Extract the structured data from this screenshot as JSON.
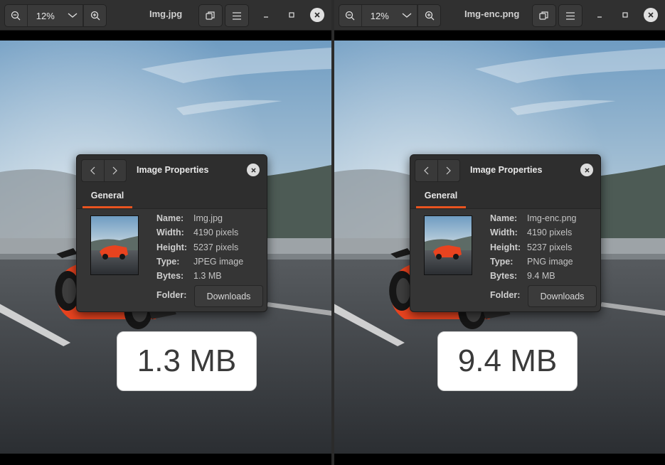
{
  "windows": [
    {
      "zoom": "12%",
      "title": "Img.jpg",
      "dialog": {
        "title": "Image Properties",
        "tab": "General",
        "labels": {
          "name": "Name:",
          "width": "Width:",
          "height": "Height:",
          "type": "Type:",
          "bytes": "Bytes:",
          "folder": "Folder:"
        },
        "name": "Img.jpg",
        "width": "4190 pixels",
        "height": "5237 pixels",
        "type": "JPEG image",
        "bytes": "1.3 MB",
        "folder": "Downloads"
      },
      "size_label": "1.3 MB"
    },
    {
      "zoom": "12%",
      "title": "Img-enc.png",
      "dialog": {
        "title": "Image Properties",
        "tab": "General",
        "labels": {
          "name": "Name:",
          "width": "Width:",
          "height": "Height:",
          "type": "Type:",
          "bytes": "Bytes:",
          "folder": "Folder:"
        },
        "name": "Img-enc.png",
        "width": "4190 pixels",
        "height": "5237 pixels",
        "type": "PNG image",
        "bytes": "9.4 MB",
        "folder": "Downloads"
      },
      "size_label": "9.4 MB"
    }
  ],
  "icons": {
    "zoom_out": "zoom-out-icon",
    "zoom_dropdown": "chevron-down-icon",
    "zoom_in": "zoom-in-icon",
    "fit": "fit-window-icon",
    "menu": "hamburger-menu-icon",
    "minimize": "minimize-icon",
    "maximize": "maximize-icon",
    "close": "close-icon",
    "prev": "chevron-left-icon",
    "next": "chevron-right-icon"
  },
  "colors": {
    "headerbar": "#303030",
    "dialog_bg": "#353535",
    "tab_accent": "#e95420",
    "car": "#e8431f"
  }
}
